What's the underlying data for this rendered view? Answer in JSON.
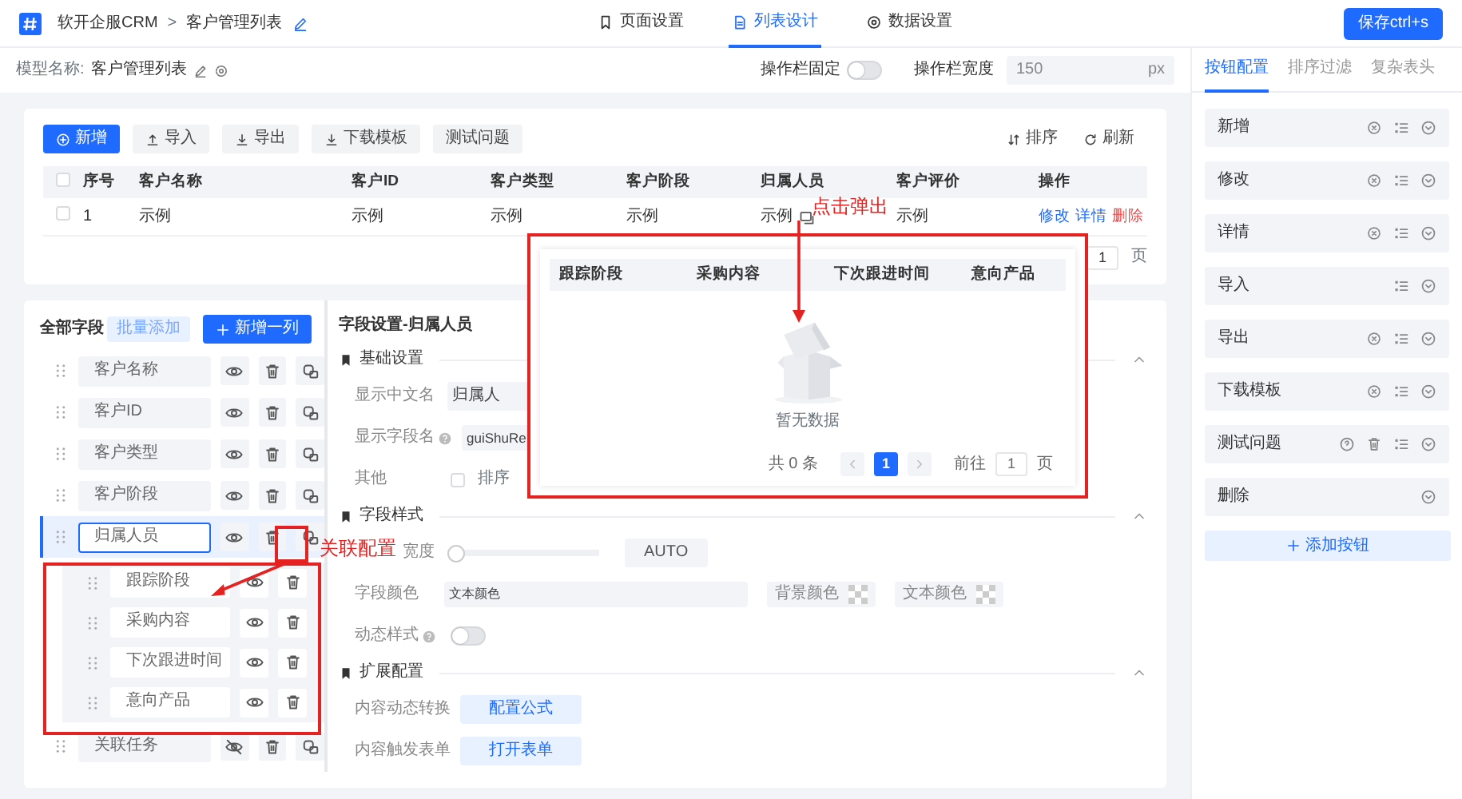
{
  "header": {
    "app": "软开企服CRM",
    "separator": ">",
    "page": "客户管理列表",
    "save": "保存ctrl+s",
    "tabs": [
      {
        "label": "页面设置",
        "kind": "page",
        "selected": false
      },
      {
        "label": "列表设计",
        "kind": "list",
        "selected": true
      },
      {
        "label": "数据设置",
        "kind": "data",
        "selected": false
      }
    ]
  },
  "model_bar": {
    "label": "模型名称:",
    "name": "客户管理列表",
    "fixed_label": "操作栏固定",
    "fixed_on": false,
    "width_label": "操作栏宽度",
    "width_value": "150",
    "width_unit": "px"
  },
  "toolbar": {
    "buttons": [
      {
        "label": "新增",
        "kind": "add"
      },
      {
        "label": "导入",
        "kind": "import"
      },
      {
        "label": "导出",
        "kind": "export"
      },
      {
        "label": "下载模板",
        "kind": "download"
      },
      {
        "label": "测试问题",
        "kind": "plain"
      }
    ],
    "right": [
      {
        "label": "排序",
        "kind": "sort"
      },
      {
        "label": "刷新",
        "kind": "refresh"
      }
    ]
  },
  "table": {
    "all_checked": false,
    "columns": [
      "序号",
      "客户名称",
      "客户ID",
      "客户类型",
      "客户阶段",
      "归属人员",
      "客户评价",
      "操作"
    ],
    "rows": [
      {
        "checked": false,
        "cells": [
          "1",
          "示例",
          "示例",
          "示例",
          "示例",
          "示例",
          "示例"
        ],
        "actions": [
          "修改",
          "详情",
          "删除"
        ]
      }
    ],
    "pagination_tail": {
      "goto_value": "1",
      "unit": "页"
    }
  },
  "fields_panel": {
    "title": "全部字段",
    "batch": "批量添加",
    "add": "新增一列",
    "fields": [
      {
        "name": "客户名称",
        "visible": true,
        "selected": false
      },
      {
        "name": "客户ID",
        "visible": true,
        "selected": false
      },
      {
        "name": "客户类型",
        "visible": true,
        "selected": false
      },
      {
        "name": "客户阶段",
        "visible": true,
        "selected": false
      },
      {
        "name": "归属人员",
        "visible": true,
        "selected": true,
        "children": [
          {
            "name": "跟踪阶段",
            "visible": true
          },
          {
            "name": "采购内容",
            "visible": true
          },
          {
            "name": "下次跟进时间",
            "visible": true
          },
          {
            "name": "意向产品",
            "visible": true
          }
        ]
      },
      {
        "name": "关联任务",
        "visible": false,
        "selected": false
      }
    ]
  },
  "settings": {
    "title": "字段设置-归属人员",
    "sections": [
      {
        "title": "基础设置",
        "expanded": true,
        "rows": [
          {
            "kind": "input",
            "label": "显示中文名",
            "value": "归属人"
          },
          {
            "kind": "input",
            "label": "显示字段名",
            "help": true,
            "value": "guiShuRe"
          },
          {
            "kind": "checkbox",
            "label": "其他",
            "option": "排序",
            "checked": false
          }
        ]
      },
      {
        "title": "字段样式",
        "expanded": true,
        "rows": [
          {
            "kind": "slider",
            "label": "宽度",
            "level": 0,
            "button": "AUTO"
          },
          {
            "kind": "color",
            "label": "字段颜色",
            "value": "文本颜色",
            "swatches": [
              "背景颜色",
              "文本颜色"
            ]
          },
          {
            "kind": "switch",
            "label": "动态样式",
            "help": true,
            "on": false
          }
        ]
      },
      {
        "title": "扩展配置",
        "expanded": true,
        "rows": [
          {
            "kind": "button",
            "label": "内容动态转换",
            "button": "配置公式"
          },
          {
            "kind": "button",
            "label": "内容触发表单",
            "button": "打开表单"
          }
        ]
      }
    ]
  },
  "right_panel": {
    "tabs": [
      {
        "label": "按钮配置",
        "selected": true
      },
      {
        "label": "排序过滤",
        "selected": false
      },
      {
        "label": "复杂表头",
        "selected": false
      }
    ],
    "buttons": [
      {
        "label": "新增",
        "help": false,
        "settings": true,
        "deletable": false,
        "sortable": true
      },
      {
        "label": "修改",
        "help": false,
        "settings": true,
        "deletable": false,
        "sortable": true
      },
      {
        "label": "详情",
        "help": false,
        "settings": true,
        "deletable": false,
        "sortable": true
      },
      {
        "label": "导入",
        "help": false,
        "settings": false,
        "deletable": false,
        "sortable": true
      },
      {
        "label": "导出",
        "help": false,
        "settings": true,
        "deletable": false,
        "sortable": true
      },
      {
        "label": "下载模板",
        "help": false,
        "settings": true,
        "deletable": false,
        "sortable": true
      },
      {
        "label": "测试问题",
        "help": true,
        "settings": false,
        "deletable": true,
        "sortable": true
      },
      {
        "label": "删除",
        "help": false,
        "settings": false,
        "deletable": false,
        "sortable": false
      }
    ],
    "add": "添加按钮"
  },
  "popup": {
    "columns": [
      "跟踪阶段",
      "采购内容",
      "下次跟进时间",
      "意向产品"
    ],
    "empty": "暂无数据",
    "total": "共 0 条",
    "pages": [
      {
        "label": "1",
        "selected": true
      }
    ],
    "goto": "前往",
    "goto_value": "1",
    "unit": "页"
  },
  "annotations": [
    {
      "text": "点击弹出",
      "kind": "popup"
    },
    {
      "text": "关联配置",
      "kind": "relation"
    }
  ]
}
